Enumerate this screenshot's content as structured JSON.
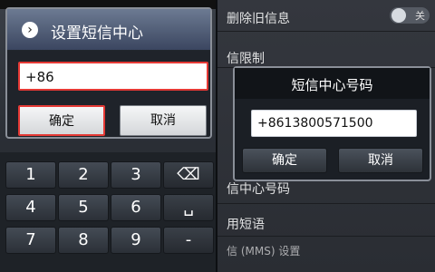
{
  "left": {
    "dialog": {
      "title": "设置短信中心",
      "input_value": "+86",
      "ok": "确定",
      "cancel": "取消"
    },
    "keypad": {
      "keys": [
        "1",
        "2",
        "3",
        "⌫",
        "4",
        "5",
        "6",
        "␣",
        "7",
        "8",
        "9",
        "-"
      ]
    }
  },
  "right": {
    "menu": {
      "items": [
        {
          "label": "删除旧信息"
        },
        {
          "label": "信限制"
        },
        {
          "label": "信中心号码"
        },
        {
          "label": "用短语"
        },
        {
          "label": "信 (MMS) 设置"
        }
      ],
      "toggle_label": "关"
    },
    "dialog": {
      "title": "短信中心号码",
      "input_value": "+8613800571500",
      "ok": "确定",
      "cancel": "取消"
    }
  }
}
